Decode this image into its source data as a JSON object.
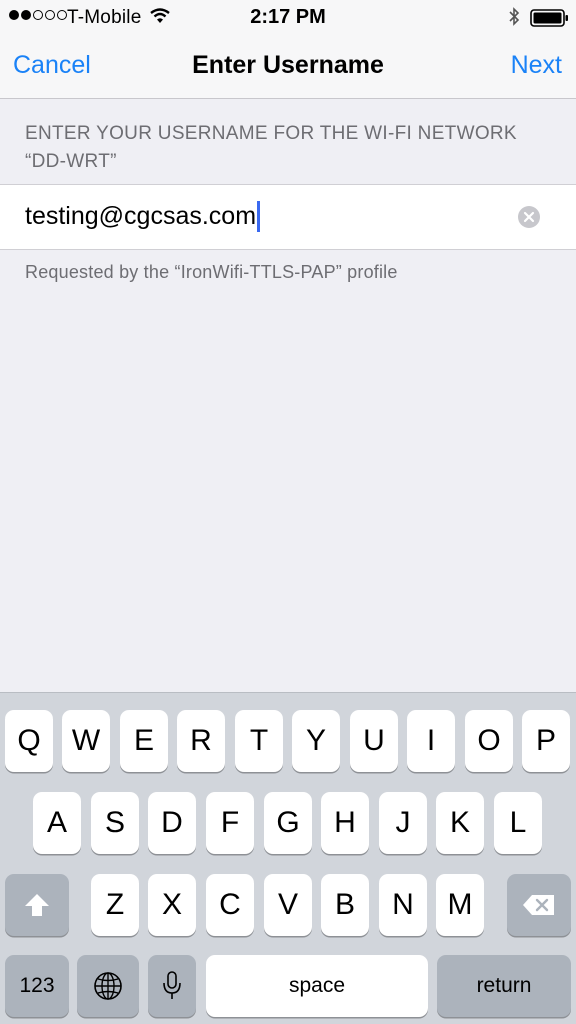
{
  "status_bar": {
    "carrier": "T-Mobile",
    "time": "2:17 PM",
    "signal_bars_filled": 2,
    "signal_bars_total": 5
  },
  "nav": {
    "cancel_label": "Cancel",
    "title": "Enter Username",
    "next_label": "Next",
    "accent_color": "#1a82f7"
  },
  "form": {
    "header_line1": "ENTER YOUR USERNAME FOR THE WI-FI NETWORK",
    "header_line2": "“DD-WRT”",
    "username_value": "testing@cgcsas.com",
    "footer_note": "Requested by the “IronWifi-TTLS-PAP” profile"
  },
  "keyboard": {
    "row1": [
      "Q",
      "W",
      "E",
      "R",
      "T",
      "Y",
      "U",
      "I",
      "O",
      "P"
    ],
    "row2": [
      "A",
      "S",
      "D",
      "F",
      "G",
      "H",
      "J",
      "K",
      "L"
    ],
    "row3": [
      "Z",
      "X",
      "C",
      "V",
      "B",
      "N",
      "M"
    ],
    "numbers_label": "123",
    "space_label": "space",
    "return_label": "return",
    "icons": {
      "shift": "shift-icon",
      "delete": "delete-icon",
      "globe": "globe-icon",
      "mic": "microphone-icon"
    }
  }
}
